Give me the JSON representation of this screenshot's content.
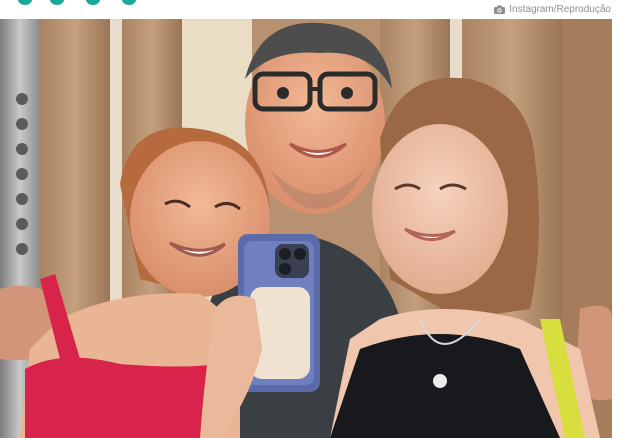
{
  "credit": {
    "icon": "camera-icon",
    "text": "Instagram/Reprodução"
  },
  "brand": {
    "accent_color": "#1aa89a"
  },
  "photo": {
    "subject": "mirror-selfie-photo"
  }
}
